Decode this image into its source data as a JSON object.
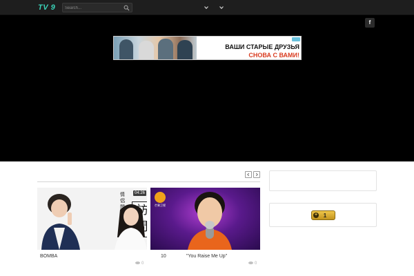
{
  "header": {
    "logo_text": "TV 9",
    "search": {
      "placeholder": "Search..."
    },
    "icons": {
      "search": "search-icon",
      "menu1": "chevron-down-icon",
      "menu2": "chevron-down-icon"
    }
  },
  "hero": {
    "social": {
      "label": "f",
      "icon": "facebook-icon"
    },
    "ad": {
      "line1": "ВАШИ СТАРЫЕ ДРУЗЬЯ",
      "line2": "СНОВА С ВАМИ!"
    }
  },
  "section": {
    "icons": {
      "prev": "chevron-left-icon",
      "next": "chevron-right-icon"
    }
  },
  "videos": [
    {
      "title": "BOMBA",
      "duration": "04:26",
      "views": "0",
      "thumb_text_small": "情侶問",
      "thumb_text_big": "訪問"
    },
    {
      "title_prefix": "10",
      "title": "\"You Raise Me Up\"",
      "views": "0",
      "channel_logo_text": "芒果卫视"
    }
  ],
  "sidebar": {
    "counter_value": "1"
  },
  "colors": {
    "nav_bg": "#1e1e1e",
    "logo": "#3ad1b6",
    "hero_bg": "#000000",
    "ad_accent": "#d93b1f",
    "badge_gold": "#f0c64a"
  }
}
